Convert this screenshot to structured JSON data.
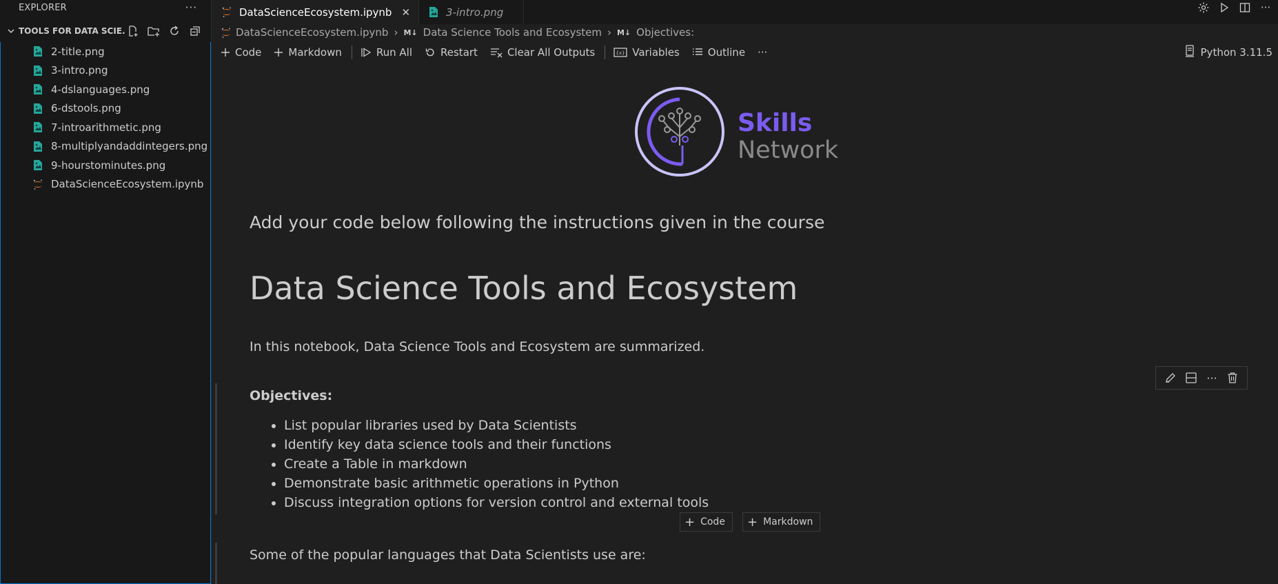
{
  "sidebar": {
    "title": "EXPLORER",
    "more": "···",
    "section": "TOOLS FOR DATA SCIE...",
    "files": [
      {
        "name": "2-title.png",
        "type": "image"
      },
      {
        "name": "3-intro.png",
        "type": "image"
      },
      {
        "name": "4-dslanguages.png",
        "type": "image"
      },
      {
        "name": "6-dstools.png",
        "type": "image"
      },
      {
        "name": "7-introarithmetic.png",
        "type": "image"
      },
      {
        "name": "8-multiplyandaddintegers.png",
        "type": "image"
      },
      {
        "name": "9-hourstominutes.png",
        "type": "image"
      },
      {
        "name": "DataScienceEcosystem.ipynb",
        "type": "notebook"
      }
    ]
  },
  "tabs": [
    {
      "label": "DataScienceEcosystem.ipynb",
      "active": true
    },
    {
      "label": "3-intro.png",
      "active": false
    }
  ],
  "breadcrumb": {
    "file": "DataScienceEcosystem.ipynb",
    "md1": "M↓",
    "section1": "Data Science Tools and Ecosystem",
    "md2": "M↓",
    "section2": "Objectives:"
  },
  "toolbar": {
    "code": "Code",
    "markdown": "Markdown",
    "run_all": "Run All",
    "restart": "Restart",
    "clear": "Clear All Outputs",
    "variables": "Variables",
    "outline": "Outline",
    "more": "···",
    "kernel": "Python 3.11.5"
  },
  "logo": {
    "line1": "Skills",
    "line2": "Network"
  },
  "notebook": {
    "intro": "Add your code below following the instructions given in the course",
    "heading": "Data Science Tools and Ecosystem",
    "summary": "In this notebook, Data Science Tools and Ecosystem are summarized.",
    "objectives_title": "Objectives:",
    "objectives": [
      "List popular libraries used by Data Scientists",
      "Identify key data science tools and their functions",
      "Create a Table in markdown",
      "Demonstrate basic arithmetic operations in Python",
      "Discuss integration options for version control and external tools"
    ],
    "add_code": "Code",
    "add_markdown": "Markdown",
    "languages_intro": "Some of the popular languages that Data Scientists use are:"
  },
  "colors": {
    "accent": "#0078d4",
    "image_icon": "#26a69a",
    "notebook_icon": "#f37626",
    "logo_purple": "#7b5cf0",
    "logo_gray": "#8a8a8a"
  }
}
